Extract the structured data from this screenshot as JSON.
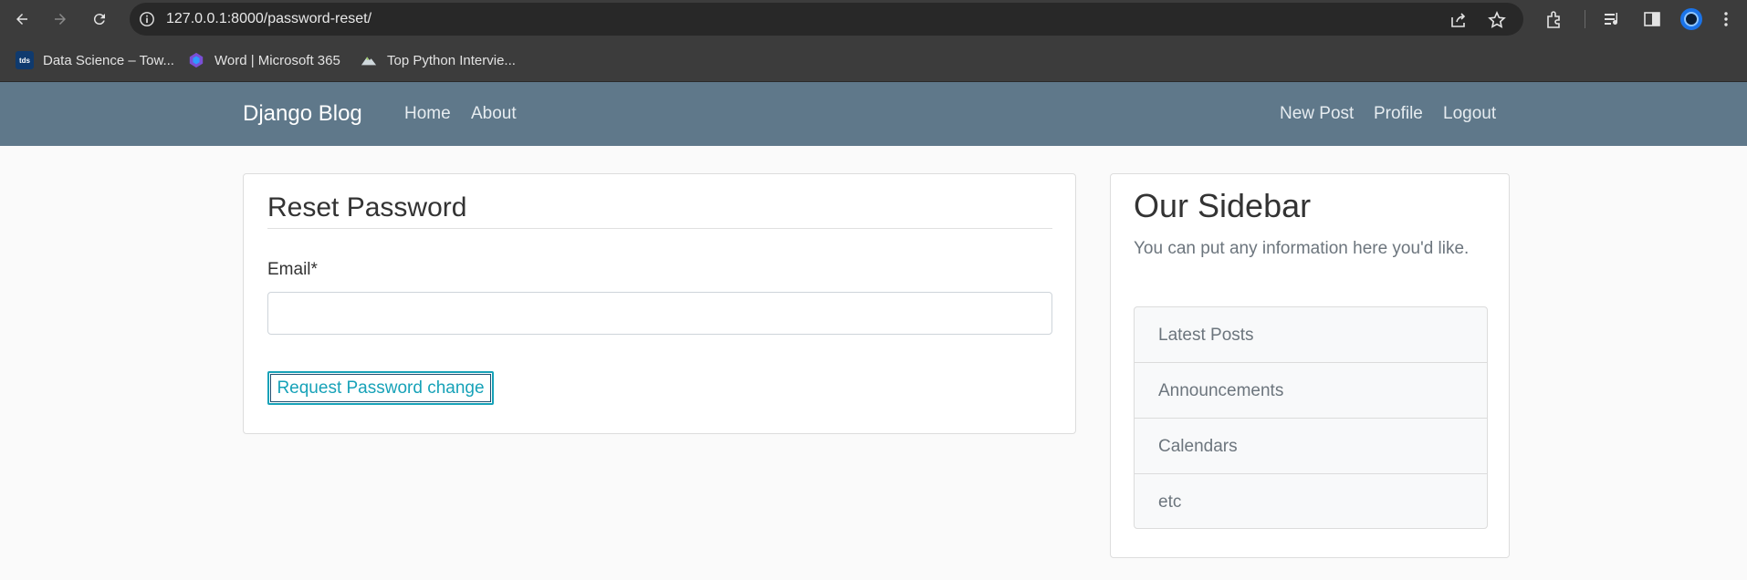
{
  "browser": {
    "url": "127.0.0.1:8000/password-reset/",
    "bookmarks": [
      {
        "label": "Data Science – Tow...",
        "icon": "tds-favicon"
      },
      {
        "label": "Word | Microsoft 365",
        "icon": "microsoft-365-favicon"
      },
      {
        "label": "Top Python Intervie...",
        "icon": "mountain-favicon"
      }
    ],
    "colors": {
      "toolbar": "#3c3c3c",
      "omnibox": "#282828"
    }
  },
  "site": {
    "brand": "Django Blog",
    "nav_left": [
      "Home",
      "About"
    ],
    "nav_right": [
      "New Post",
      "Profile",
      "Logout"
    ],
    "colors": {
      "navbar": "#5f788a",
      "accent": "#17a2b8"
    }
  },
  "form": {
    "legend": "Reset Password",
    "email_label": "Email*",
    "email_value": "",
    "submit_label": "Request Password change"
  },
  "sidebar": {
    "title": "Our Sidebar",
    "text": "You can put any information here you'd like.",
    "items": [
      "Latest Posts",
      "Announcements",
      "Calendars",
      "etc"
    ]
  }
}
